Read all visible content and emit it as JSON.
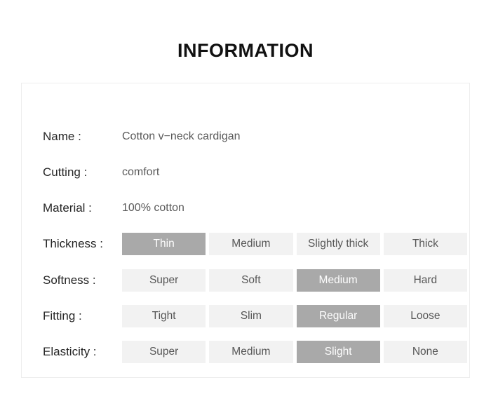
{
  "page": {
    "title": "INFORMATION",
    "accent_selected_bg": "#a9a9a9",
    "accent_selected_text": "#fdfdfd",
    "cell_bg": "#f2f2f2",
    "cell_text": "#575757",
    "label_color": "#262626",
    "value_color": "#5a5a5a",
    "card_border": "#ededed"
  },
  "text_rows": [
    {
      "label": "Name :",
      "value": "Cotton v−neck cardigan"
    },
    {
      "label": "Cutting :",
      "value": "comfort"
    },
    {
      "label": "Material :",
      "value": "100% cotton"
    }
  ],
  "option_rows": [
    {
      "label": "Thickness :",
      "selected_index": 0,
      "options": [
        "Thin",
        "Medium",
        "Slightly thick",
        "Thick"
      ]
    },
    {
      "label": "Softness :",
      "selected_index": 2,
      "options": [
        "Super",
        "Soft",
        "Medium",
        "Hard"
      ]
    },
    {
      "label": "Fitting :",
      "selected_index": 2,
      "options": [
        "Tight",
        "Slim",
        "Regular",
        "Loose"
      ]
    },
    {
      "label": "Elasticity :",
      "selected_index": 2,
      "options": [
        "Super",
        "Medium",
        "Slight",
        "None"
      ]
    }
  ]
}
